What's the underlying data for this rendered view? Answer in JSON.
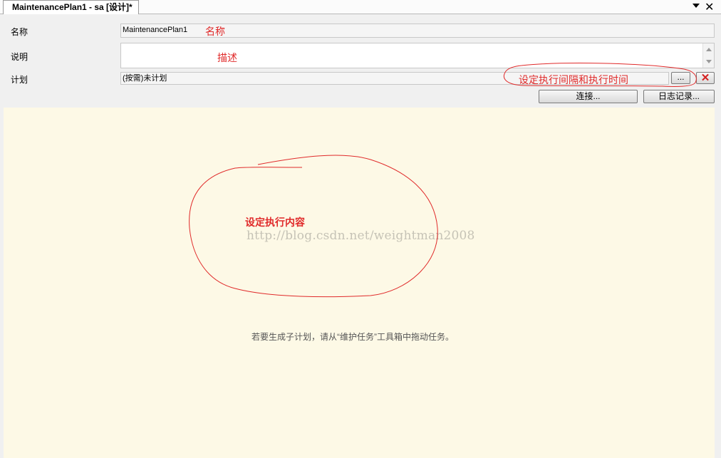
{
  "tab": {
    "title": "MaintenancePlan1 - sa [设计]*"
  },
  "form": {
    "name_label": "名称",
    "name_value": "MaintenancePlan1",
    "desc_label": "说明",
    "desc_value": "",
    "schedule_label": "计划",
    "schedule_value": "(按需)未计划",
    "schedule_edit_label": "...",
    "connection_button": "连接...",
    "log_button": "日志记录..."
  },
  "annotations": {
    "name_note": "名称",
    "desc_note": "描述",
    "schedule_note": "设定执行间隔和执行时间",
    "content_note": "设定执行内容",
    "color": "#e02a2a"
  },
  "designer": {
    "watermark": "http://blog.csdn.net/weightman2008",
    "hint": "若要生成子计划，请从“维护任务”工具箱中拖动任务。"
  }
}
